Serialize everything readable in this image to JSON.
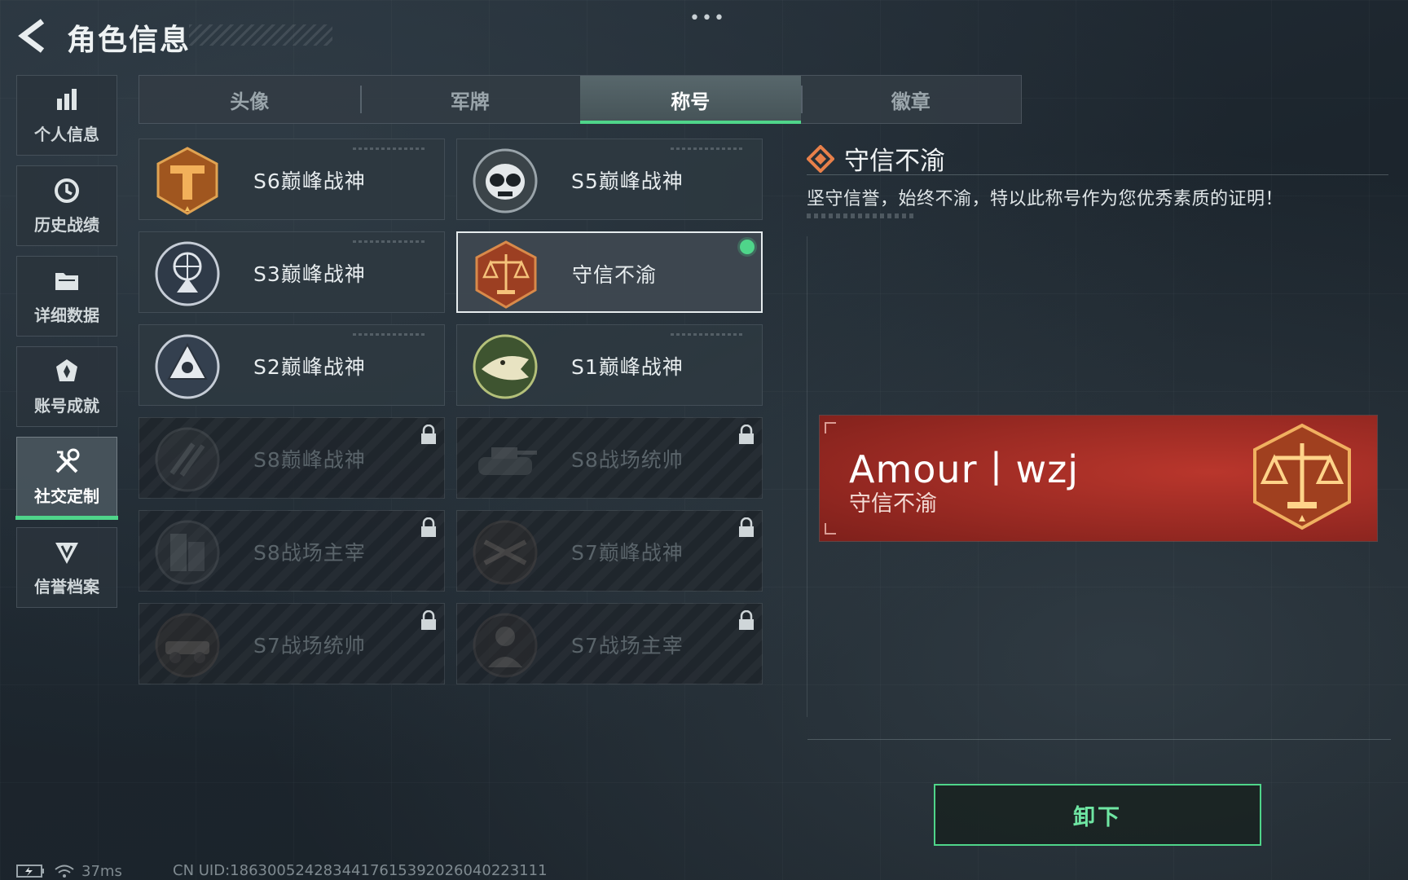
{
  "header": {
    "title": "角色信息",
    "more_dots": "•••"
  },
  "sidebar": {
    "items": [
      {
        "label": "个人信息",
        "icon": "bar-chart-icon"
      },
      {
        "label": "历史战绩",
        "icon": "history-icon"
      },
      {
        "label": "详细数据",
        "icon": "folder-icon"
      },
      {
        "label": "账号成就",
        "icon": "achievement-icon"
      },
      {
        "label": "社交定制",
        "icon": "tools-icon",
        "active": true
      },
      {
        "label": "信誉档案",
        "icon": "reputation-icon"
      }
    ]
  },
  "tabs": [
    {
      "label": "头像"
    },
    {
      "label": "军牌"
    },
    {
      "label": "称号",
      "active": true
    },
    {
      "label": "徽章"
    }
  ],
  "titles": [
    {
      "name": "S6巅峰战神",
      "locked": false,
      "badge_color": "#c8782c",
      "icon": "t-emblem-icon"
    },
    {
      "name": "S5巅峰战神",
      "locked": false,
      "badge_color": "#7d878c",
      "icon": "skull-goggles-icon"
    },
    {
      "name": "S3巅峰战神",
      "locked": false,
      "badge_color": "#8c96a8",
      "icon": "atlas-emblem-icon"
    },
    {
      "name": "守信不渝",
      "locked": false,
      "selected": true,
      "equipped": true,
      "badge_color": "#b5532c",
      "icon": "scales-icon"
    },
    {
      "name": "S2巅峰战神",
      "locked": false,
      "badge_color": "#9aa6b8",
      "icon": "triangle-emblem-icon"
    },
    {
      "name": "S1巅峰战神",
      "locked": false,
      "badge_color": "#5f7a3a",
      "icon": "crocodile-icon"
    },
    {
      "name": "S8巅峰战神",
      "locked": true,
      "badge_color": "#3a454d",
      "icon": "slash-emblem-icon"
    },
    {
      "name": "S8战场统帅",
      "locked": true,
      "badge_color": "#3a454d",
      "icon": "tank-icon"
    },
    {
      "name": "S8战场主宰",
      "locked": true,
      "badge_color": "#3a454d",
      "icon": "building-icon"
    },
    {
      "name": "S7巅峰战神",
      "locked": true,
      "badge_color": "#5a3a28",
      "icon": "crossbow-icon"
    },
    {
      "name": "S7战场统帅",
      "locked": true,
      "badge_color": "#5a3a28",
      "icon": "vehicle-icon"
    },
    {
      "name": "S7战场主宰",
      "locked": true,
      "badge_color": "#4a3a30",
      "icon": "soldier-icon"
    }
  ],
  "detail": {
    "title": "守信不渝",
    "description": "坚守信誉，始终不渝，特以此称号作为您优秀素质的证明！",
    "preview": {
      "player_name": "Amour丨wzj",
      "title": "守信不渝",
      "card_color": "#a62e26"
    },
    "action_label": "卸下"
  },
  "status": {
    "ping": "37ms",
    "uid": "CN UID:1863005242834417615392026040223111"
  },
  "colors": {
    "accent_green": "#4fd58a",
    "selected_border": "#e6ecee"
  }
}
